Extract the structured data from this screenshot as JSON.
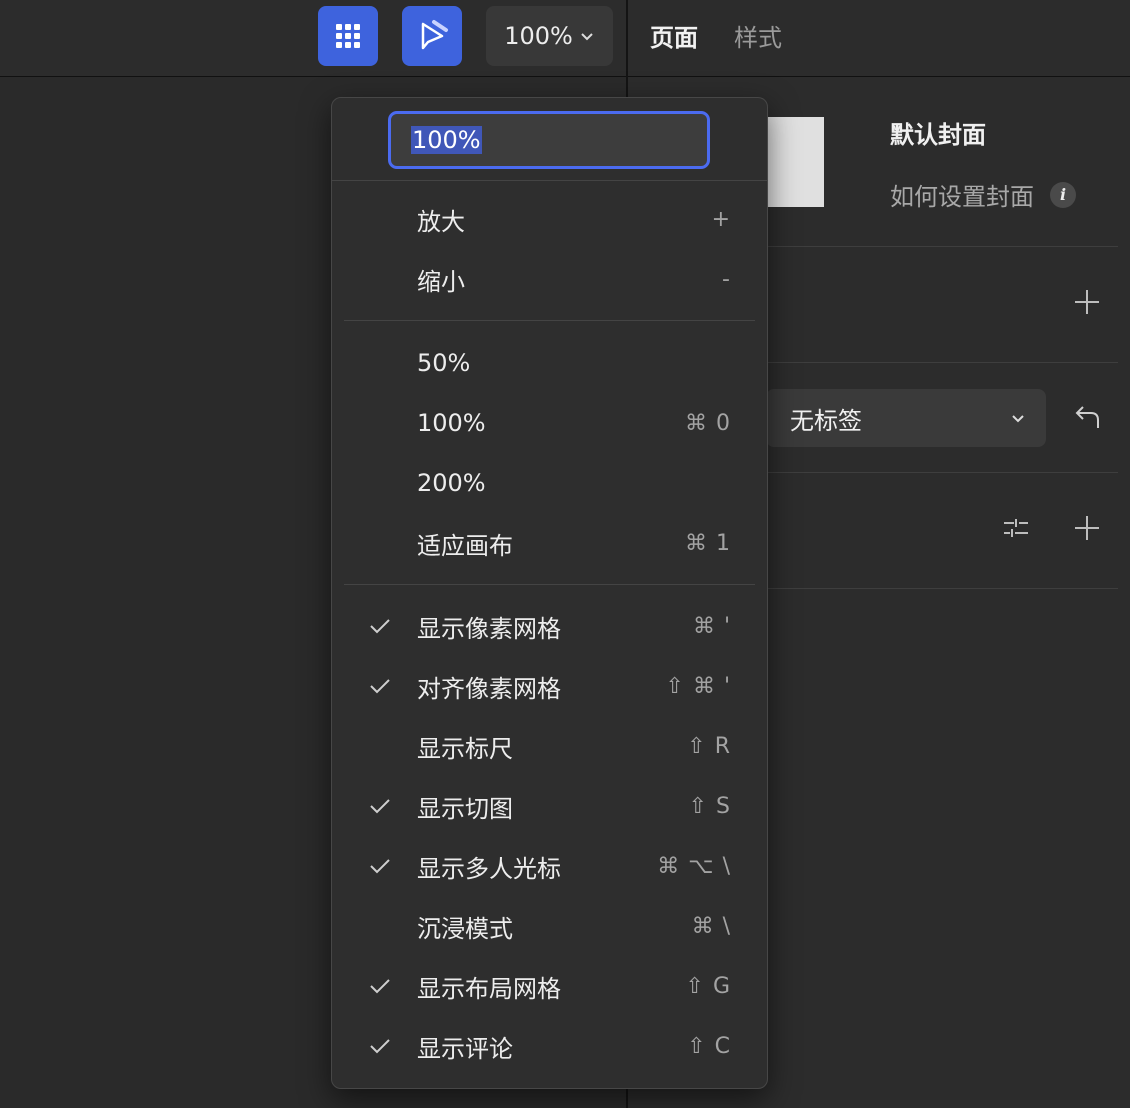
{
  "toolbar": {
    "zoom_label": "100%",
    "grid_icon": "grid-icon",
    "pen_icon": "pen-cursor-icon",
    "accent": "#3e63dd"
  },
  "right_panel": {
    "tabs": [
      {
        "label": "页面",
        "active": true
      },
      {
        "label": "样式",
        "active": false
      }
    ],
    "cover_title": "默认封面",
    "cover_help": "如何设置封面",
    "tag_select_value": "无标签"
  },
  "zoom_menu": {
    "input_value": "100%",
    "items": [
      {
        "label": "放大",
        "shortcut": "+",
        "checked": false
      },
      {
        "label": "缩小",
        "shortcut": "-",
        "checked": false
      },
      {
        "label": "50%",
        "shortcut": "",
        "checked": false
      },
      {
        "label": "100%",
        "shortcut": "⌘ 0",
        "checked": false
      },
      {
        "label": "200%",
        "shortcut": "",
        "checked": false
      },
      {
        "label": "适应画布",
        "shortcut": "⌘ 1",
        "checked": false
      },
      {
        "label": "显示像素网格",
        "shortcut": "⌘ '",
        "checked": true
      },
      {
        "label": "对齐像素网格",
        "shortcut": "⇧ ⌘ '",
        "checked": true
      },
      {
        "label": "显示标尺",
        "shortcut": "⇧ R",
        "checked": false
      },
      {
        "label": "显示切图",
        "shortcut": "⇧ S",
        "checked": true
      },
      {
        "label": "显示多人光标",
        "shortcut": "⌘ ⌥ \\",
        "checked": true
      },
      {
        "label": "沉浸模式",
        "shortcut": "⌘ \\",
        "checked": false
      },
      {
        "label": "显示布局网格",
        "shortcut": "⇧ G",
        "checked": true
      },
      {
        "label": "显示评论",
        "shortcut": "⇧ C",
        "checked": true
      }
    ]
  }
}
